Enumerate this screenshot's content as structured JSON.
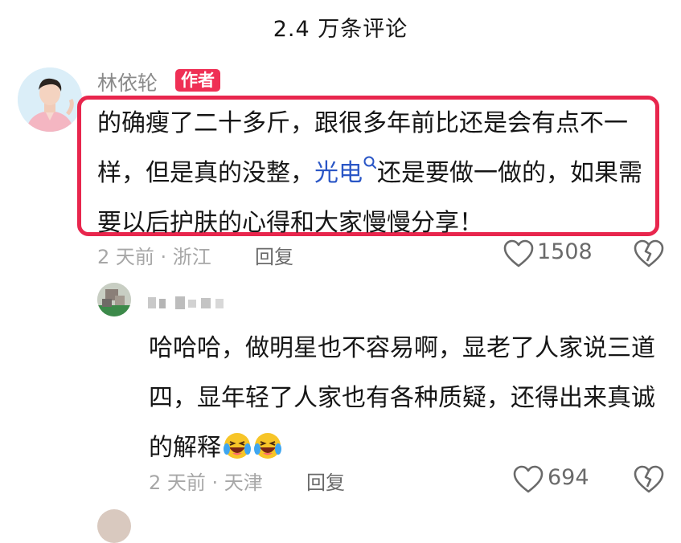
{
  "header": {
    "title": "2.4 万条评论"
  },
  "comment1": {
    "username": "林依轮",
    "badge": "作者",
    "text_before": "的确瘦了二十多斤，跟很多年前比还是会有点不一样，但是真的没整，",
    "keyword": "光电",
    "text_after": "还是要做一做的，如果需要以后护肤的心得和大家慢慢分享！",
    "meta": "2 天前 · 浙江",
    "reply_label": "回复",
    "likes": "1508"
  },
  "comment2": {
    "text": "哈哈哈，做明星也不容易啊，显老了人家说三道四，显年轻了人家也有各种质疑，还得出来真诚的解释",
    "meta": "2 天前 · 天津",
    "reply_label": "回复",
    "likes": "694"
  },
  "colors": {
    "highlight_border": "#e8264d",
    "badge_bg": "#ef2f55",
    "keyword": "#2a56c6"
  },
  "icons": [
    "heart-outline-icon",
    "broken-heart-icon",
    "search-keyword-icon",
    "laughing-crying-emoji"
  ]
}
